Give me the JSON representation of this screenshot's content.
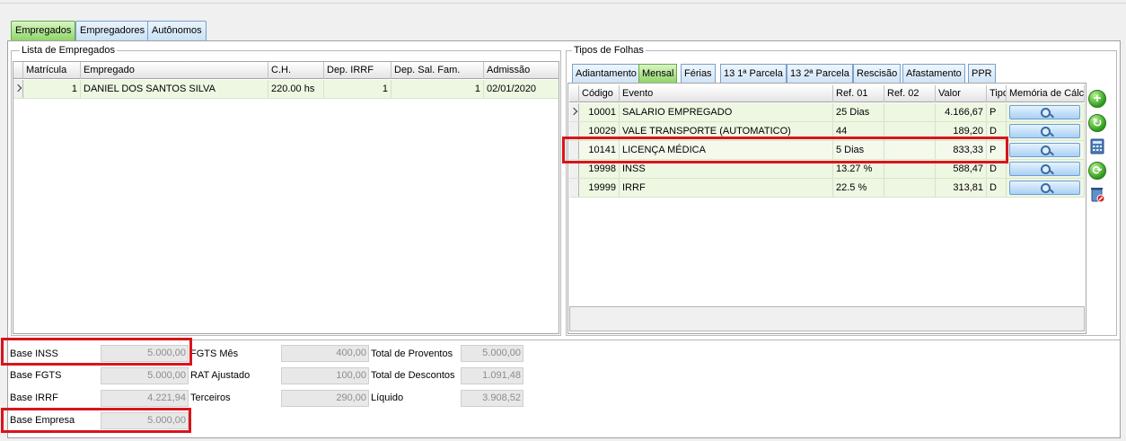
{
  "main_tabs": [
    {
      "label": "Empregados",
      "active": true
    },
    {
      "label": "Empregadores",
      "active": false
    },
    {
      "label": "Autônomos",
      "active": false
    }
  ],
  "employees": {
    "title": "Lista de Empregados",
    "columns": [
      "Matrícula",
      "Empregado",
      "C.H.",
      "Dep. IRRF",
      "Dep. Sal. Fam.",
      "Admissão"
    ],
    "rows": [
      {
        "matricula": "1",
        "empregado": "DANIEL DOS SANTOS SILVA",
        "ch": "220.00 hs",
        "dep_irrf": "1",
        "dep_sal_fam": "1",
        "admissao": "02/01/2020"
      }
    ]
  },
  "folhas": {
    "title": "Tipos de Folhas",
    "tabs": [
      {
        "label": "Adiantamento",
        "active": false
      },
      {
        "label": "Mensal",
        "active": true
      },
      {
        "label": "Férias",
        "active": false
      },
      {
        "label": "13 1ª Parcela",
        "active": false
      },
      {
        "label": "13 2ª Parcela",
        "active": false
      },
      {
        "label": "Rescisão",
        "active": false
      },
      {
        "label": "Afastamento",
        "active": false
      },
      {
        "label": "PPR",
        "active": false
      }
    ],
    "columns": [
      "Código",
      "Evento",
      "Ref. 01",
      "Ref. 02",
      "Valor",
      "Tipo",
      "Memória de Cálc"
    ],
    "rows": [
      {
        "codigo": "10001",
        "evento": "SALARIO EMPREGADO",
        "ref01": "25 Dias",
        "ref02": "",
        "valor": "4.166,67",
        "tipo": "P"
      },
      {
        "codigo": "10029",
        "evento": "VALE TRANSPORTE (AUTOMATICO)",
        "ref01": "44",
        "ref02": "",
        "valor": "189,20",
        "tipo": "D"
      },
      {
        "codigo": "10141",
        "evento": "LICENÇA MÉDICA",
        "ref01": "5 Dias",
        "ref02": "",
        "valor": "833,33",
        "tipo": "P"
      },
      {
        "codigo": "19998",
        "evento": "INSS",
        "ref01": "13.27 %",
        "ref02": "",
        "valor": "588,47",
        "tipo": "D"
      },
      {
        "codigo": "19999",
        "evento": "IRRF",
        "ref01": "22.5 %",
        "ref02": "",
        "valor": "313,81",
        "tipo": "D"
      }
    ],
    "side_tools": [
      "add-icon",
      "refresh-icon",
      "calculator-icon",
      "recalculate-icon",
      "delete-icon"
    ]
  },
  "totals": {
    "base_inss": {
      "label": "Base INSS",
      "value": "5.000,00"
    },
    "base_fgts": {
      "label": "Base FGTS",
      "value": "5.000,00"
    },
    "base_irrf": {
      "label": "Base IRRF",
      "value": "4.221,94"
    },
    "base_empresa": {
      "label": "Base Empresa",
      "value": "5.000,00"
    },
    "fgts_mes": {
      "label": "FGTS Mês",
      "value": "400,00"
    },
    "rat_ajustado": {
      "label": "RAT Ajustado",
      "value": "100,00"
    },
    "terceiros": {
      "label": "Terceiros",
      "value": "290,00"
    },
    "total_proventos": {
      "label": "Total de Proventos",
      "value": "5.000,00"
    },
    "total_descontos": {
      "label": "Total de Descontos",
      "value": "1.091,48"
    },
    "liquido": {
      "label": "Líquido",
      "value": "3.908,52"
    }
  },
  "colors": {
    "highlight": "#d9141b",
    "active_tab": "#8fd56a",
    "row_bg": "#eef7e2"
  }
}
